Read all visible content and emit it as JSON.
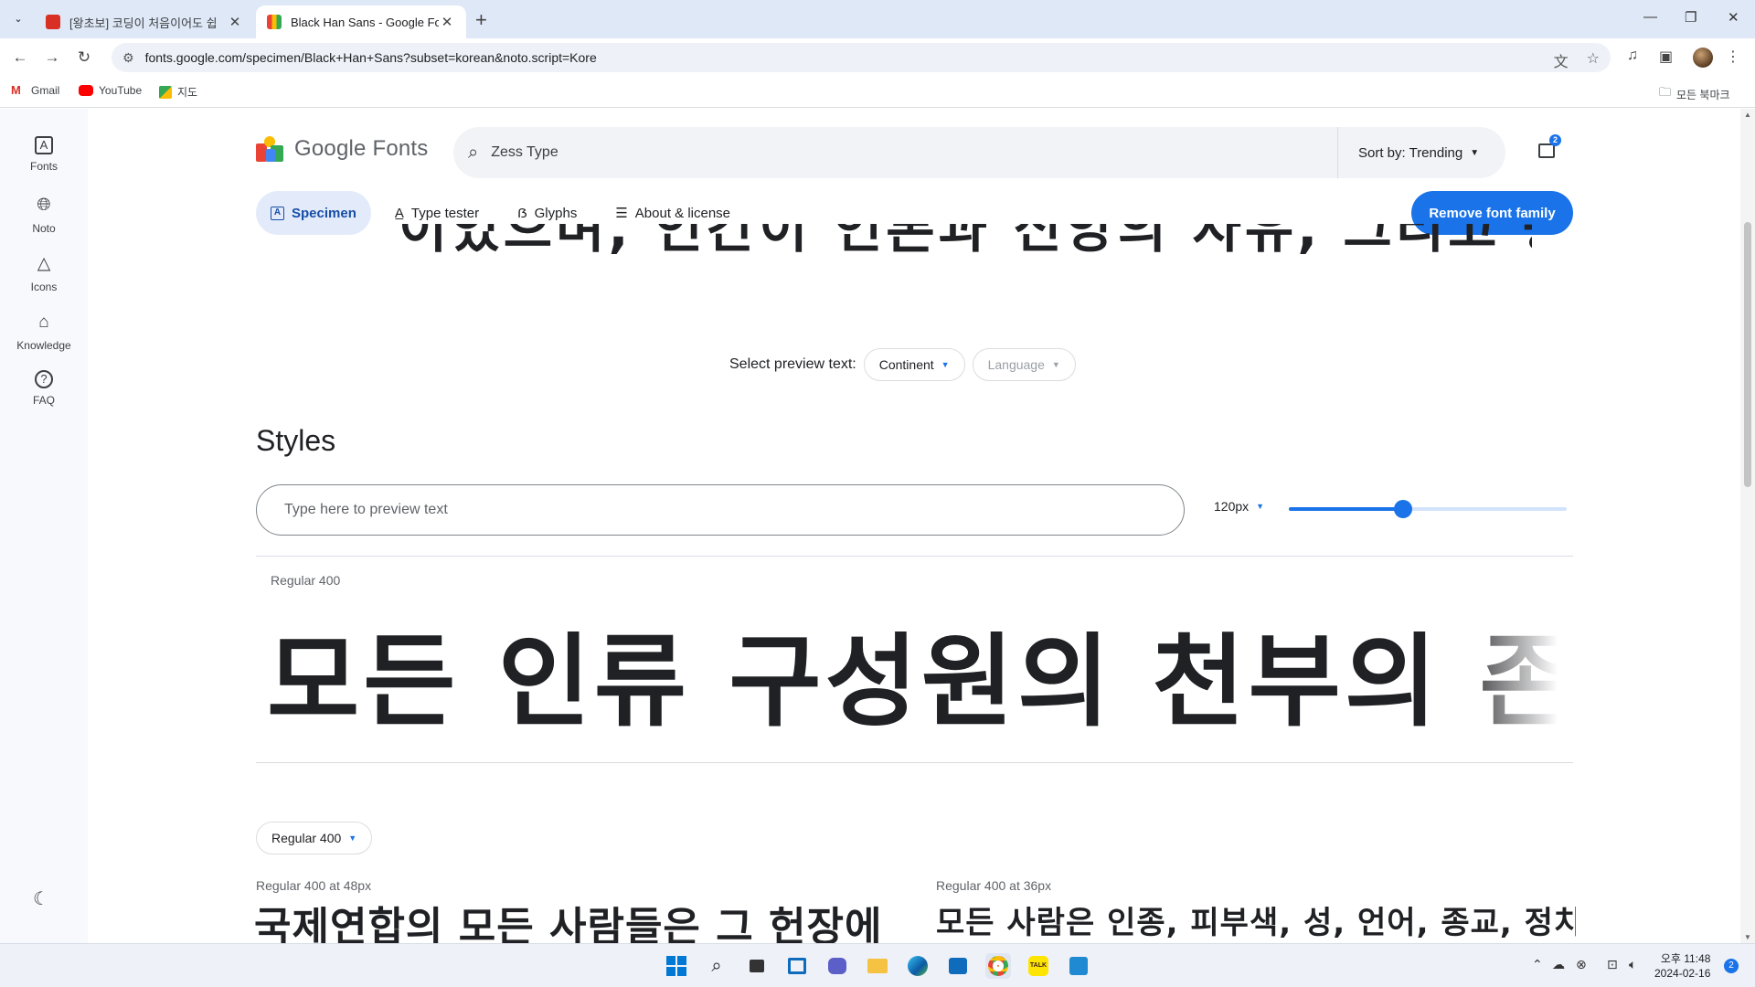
{
  "browser": {
    "tabs": [
      {
        "title": "[왕초보] 코딩이 처음이어도 쉽",
        "active": false
      },
      {
        "title": "Black Han Sans - Google Fonts",
        "active": true
      }
    ],
    "url": "fonts.google.com/specimen/Black+Han+Sans?subset=korean&noto.script=Kore",
    "bookmarks": [
      "Gmail",
      "YouTube",
      "지도"
    ],
    "all_bookmarks": "모든 북마크"
  },
  "rail": {
    "items": [
      {
        "label": "Fonts",
        "icon": "font-icon"
      },
      {
        "label": "Noto",
        "icon": "globe-icon"
      },
      {
        "label": "Icons",
        "icon": "shapes-icon"
      },
      {
        "label": "Knowledge",
        "icon": "school-icon"
      },
      {
        "label": "FAQ",
        "icon": "help-icon"
      }
    ]
  },
  "header": {
    "logo_text": "Google Fonts",
    "search_value": "Zess Type",
    "sort_label": "Sort by: Trending",
    "cart_count": "2"
  },
  "subnav": {
    "tabs": [
      "Specimen",
      "Type tester",
      "Glyphs",
      "About & license"
    ],
    "active_tab": "Specimen",
    "remove_button": "Remove font family"
  },
  "cut_text": "이었으며, 인간이 언론과 신앙의 자유, 그리고 공포와",
  "preview": {
    "label": "Select preview text:",
    "continent": "Continent",
    "language": "Language"
  },
  "styles": {
    "heading": "Styles",
    "input_placeholder": "Type here to preview text",
    "size": "120px",
    "size_slider_fraction": 0.41,
    "style_name": "Regular 400",
    "sample_text": "모든 인류 구성원의 천부의 존엄성"
  },
  "glyph_section": {
    "weight_select": "Regular 400",
    "caption_48": "Regular 400 at 48px",
    "caption_36": "Regular 400 at 36px",
    "sample_48": "국제연합의 모든 사람들은 그 헌장에",
    "sample_36": "모든 사람은 인종, 피부색, 성, 언어, 종교, 정치적"
  },
  "system": {
    "time": "오후 11:48",
    "date": "2024-02-16",
    "notification_count": "2"
  },
  "colors": {
    "accent": "#1a73e8",
    "active_chip_bg": "#e3ebfb",
    "chrome_bg": "#dfe8f7"
  }
}
